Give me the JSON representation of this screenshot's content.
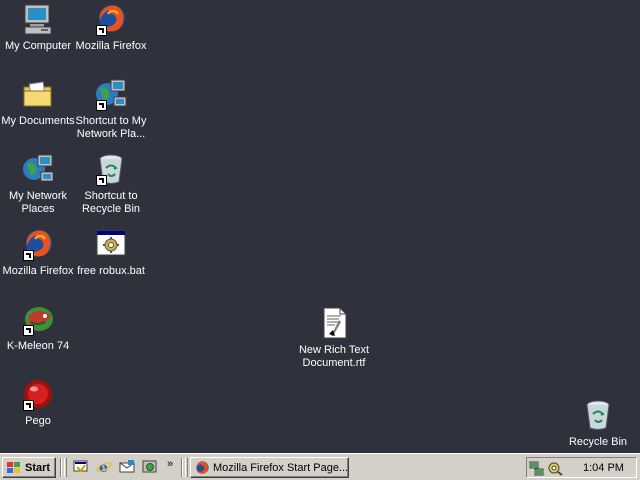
{
  "desktop": {
    "icons": [
      {
        "label": "My Computer",
        "icon": "my-computer-icon",
        "shortcut": false
      },
      {
        "label": "Mozilla Firefox",
        "icon": "firefox-icon",
        "shortcut": true
      },
      {
        "label": "My Documents",
        "icon": "folder-icon",
        "shortcut": false
      },
      {
        "label": "Shortcut to My Network Pla...",
        "icon": "network-icon",
        "shortcut": true
      },
      {
        "label": "My Network Places",
        "icon": "network-icon",
        "shortcut": false
      },
      {
        "label": "Shortcut to Recycle Bin",
        "icon": "recycle-bin-icon",
        "shortcut": true
      },
      {
        "label": "Mozilla Firefox",
        "icon": "firefox-icon",
        "shortcut": true
      },
      {
        "label": "free robux.bat",
        "icon": "batch-file-icon",
        "shortcut": false
      },
      {
        "label": "K-Meleon 74",
        "icon": "kmeleon-icon",
        "shortcut": true
      },
      {
        "label": "New Rich Text Document.rtf",
        "icon": "rtf-document-icon",
        "shortcut": false
      },
      {
        "label": "Pego",
        "icon": "pego-icon",
        "shortcut": true
      },
      {
        "label": "Recycle Bin",
        "icon": "recycle-bin-icon",
        "shortcut": false
      }
    ]
  },
  "taskbar": {
    "start_label": "Start",
    "quick_launch": [
      "show-desktop-icon",
      "internet-explorer-icon",
      "outlook-express-icon",
      "media-icon"
    ],
    "chevron": "»",
    "task_button_label": "Mozilla Firefox Start Page...",
    "tray": [
      "network-tray-icon",
      "volume-tray-icon"
    ],
    "clock": "1:04 PM"
  },
  "colors": {
    "desktop_background": "#2f323c",
    "taskbar": "#d4d0c8"
  }
}
